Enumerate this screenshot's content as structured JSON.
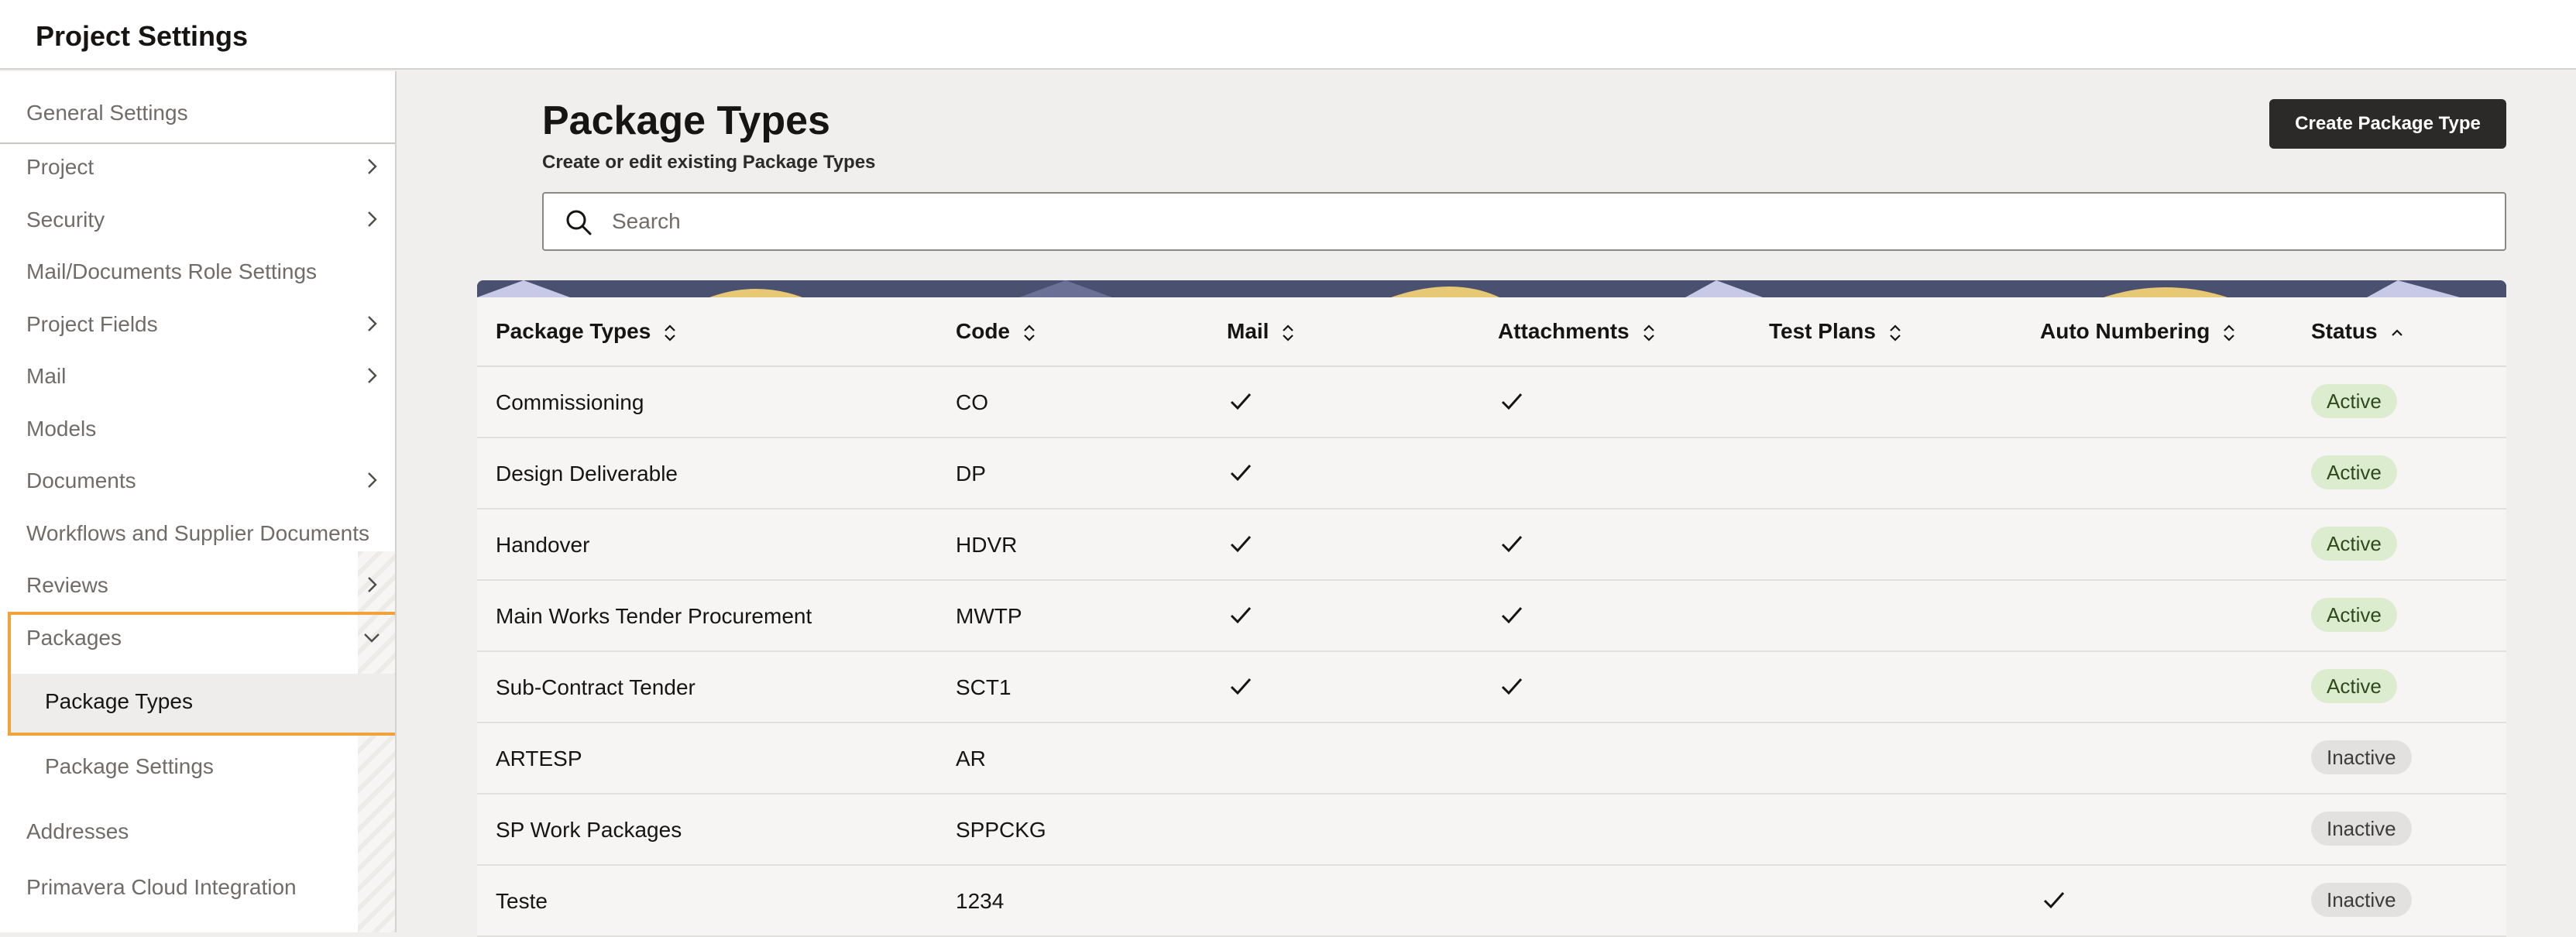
{
  "app": {
    "title": "Project Settings"
  },
  "sidebar": {
    "header": "General Settings",
    "items": [
      {
        "label": "Project",
        "chevron": "right"
      },
      {
        "label": "Security",
        "chevron": "right"
      },
      {
        "label": "Mail/Documents Role Settings",
        "chevron": "none"
      },
      {
        "label": "Project Fields",
        "chevron": "right"
      },
      {
        "label": "Mail",
        "chevron": "right"
      },
      {
        "label": "Models",
        "chevron": "none"
      },
      {
        "label": "Documents",
        "chevron": "right"
      },
      {
        "label": "Workflows and Supplier Documents",
        "chevron": "none"
      },
      {
        "label": "Reviews",
        "chevron": "right"
      },
      {
        "label": "Packages",
        "chevron": "down"
      }
    ],
    "packages_sub": {
      "active": "Package Types",
      "other": "Package Settings"
    },
    "bottom_items": [
      {
        "label": "Addresses"
      },
      {
        "label": "Primavera Cloud Integration"
      }
    ],
    "highlight_color": "#f0a33a"
  },
  "main": {
    "title": "Package Types",
    "subtitle": "Create or edit existing Package Types",
    "create_button": "Create Package Type",
    "search": {
      "placeholder": "Search",
      "value": ""
    }
  },
  "table": {
    "columns": [
      {
        "label": "Package Types",
        "sort": "both"
      },
      {
        "label": "Code",
        "sort": "both"
      },
      {
        "label": "Mail",
        "sort": "both"
      },
      {
        "label": "Attachments",
        "sort": "both"
      },
      {
        "label": "Test Plans",
        "sort": "both"
      },
      {
        "label": "Auto Numbering",
        "sort": "both"
      },
      {
        "label": "Status",
        "sort": "asc"
      }
    ],
    "rows": [
      {
        "name": "Commissioning",
        "code": "CO",
        "mail": true,
        "attachments": true,
        "test_plans": false,
        "auto_numbering": false,
        "status": "Active"
      },
      {
        "name": "Design Deliverable",
        "code": "DP",
        "mail": true,
        "attachments": false,
        "test_plans": false,
        "auto_numbering": false,
        "status": "Active"
      },
      {
        "name": "Handover",
        "code": "HDVR",
        "mail": true,
        "attachments": true,
        "test_plans": false,
        "auto_numbering": false,
        "status": "Active"
      },
      {
        "name": "Main Works Tender Procurement",
        "code": "MWTP",
        "mail": true,
        "attachments": true,
        "test_plans": false,
        "auto_numbering": false,
        "status": "Active"
      },
      {
        "name": "Sub-Contract Tender",
        "code": "SCT1",
        "mail": true,
        "attachments": true,
        "test_plans": false,
        "auto_numbering": false,
        "status": "Active"
      },
      {
        "name": "ARTESP",
        "code": "AR",
        "mail": false,
        "attachments": false,
        "test_plans": false,
        "auto_numbering": false,
        "status": "Inactive"
      },
      {
        "name": "SP Work Packages",
        "code": "SPPCKG",
        "mail": false,
        "attachments": false,
        "test_plans": false,
        "auto_numbering": false,
        "status": "Inactive"
      },
      {
        "name": "Teste",
        "code": "1234",
        "mail": false,
        "attachments": false,
        "test_plans": false,
        "auto_numbering": true,
        "status": "Inactive"
      }
    ]
  }
}
